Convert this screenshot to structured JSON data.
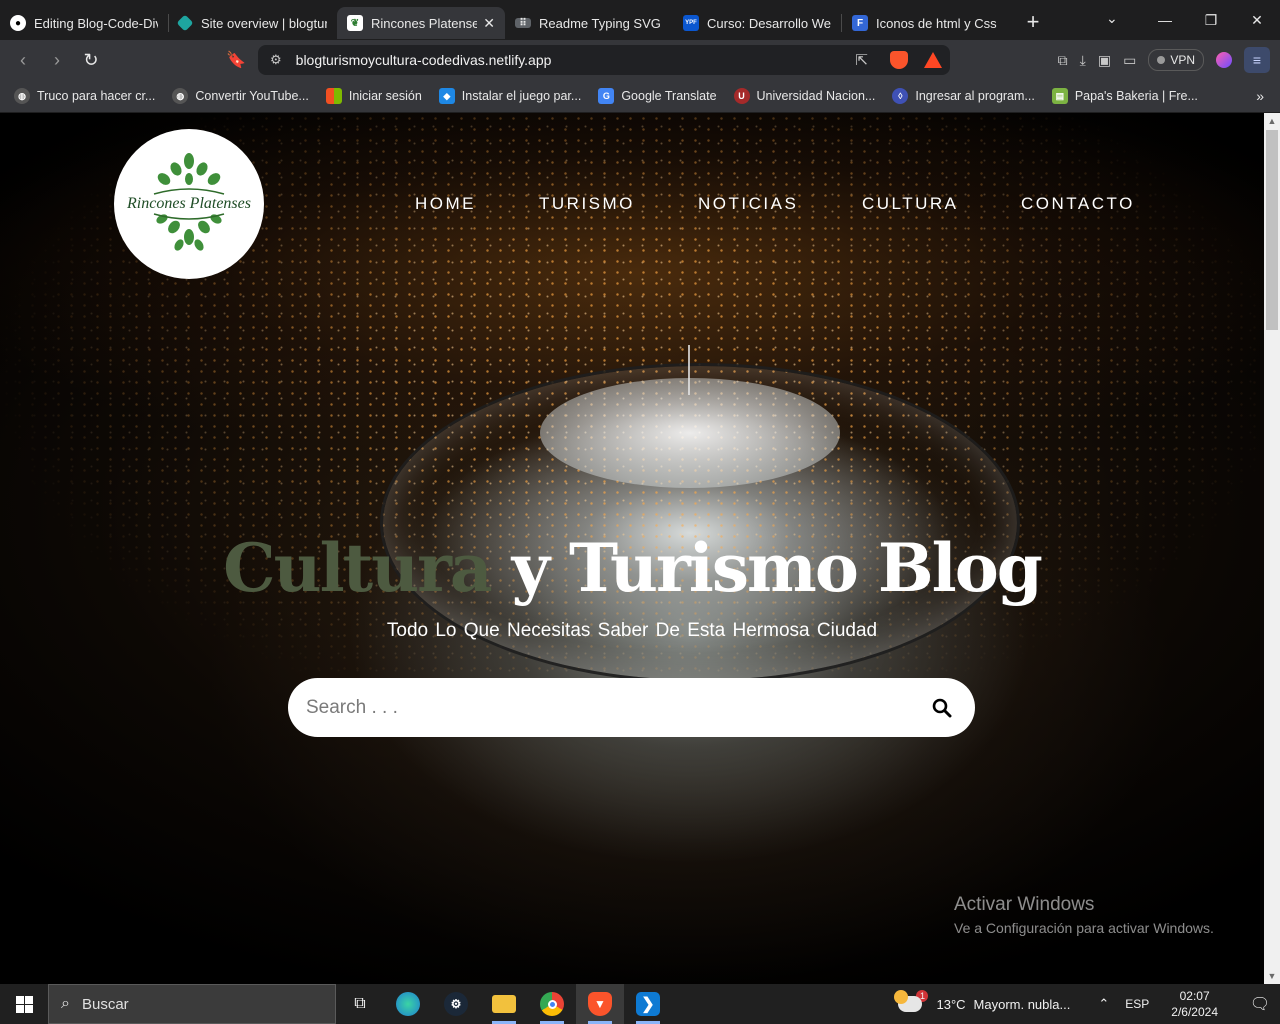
{
  "browser": {
    "tabs": [
      {
        "title": "Editing Blog-Code-Diva",
        "icon": "github-icon",
        "active": false
      },
      {
        "title": "Site overview | blogturi",
        "icon": "netlify-icon",
        "active": false
      },
      {
        "title": "Rincones Platenses",
        "icon": "leaf-icon",
        "active": true
      },
      {
        "title": "Readme Typing SVG - D",
        "icon": "keyboard-icon",
        "active": false
      },
      {
        "title": "Curso: Desarrollo Web",
        "icon": "ypf-icon",
        "active": false
      },
      {
        "title": "Iconos de html y Css | F",
        "icon": "f-icon",
        "active": false
      }
    ],
    "url": "blogturismoycultura-codedivas.netlify.app",
    "vpn_label": "VPN",
    "bookmarks": [
      {
        "label": "Truco para hacer cr...",
        "icon": "globe-icon",
        "color": "#555555"
      },
      {
        "label": "Convertir YouTube...",
        "icon": "globe-icon",
        "color": "#555555"
      },
      {
        "label": "Iniciar sesión",
        "icon": "microsoft-icon",
        "color": "#f25022"
      },
      {
        "label": "Instalar el juego par...",
        "icon": "game-icon",
        "color": "#1e88e5"
      },
      {
        "label": "Google Translate",
        "icon": "translate-icon",
        "color": "#4285f4"
      },
      {
        "label": "Universidad Nacion...",
        "icon": "university-icon",
        "color": "#a52a2a"
      },
      {
        "label": "Ingresar al program...",
        "icon": "shield-icon",
        "color": "#3f51b5"
      },
      {
        "label": "Papa's Bakeria | Fre...",
        "icon": "bakery-icon",
        "color": "#7cb342"
      }
    ]
  },
  "site": {
    "logo_text": "Rincones Platenses",
    "nav": [
      "HOME",
      "TURISMO",
      "NOTICIAS",
      "CULTURA",
      "CONTACTO"
    ],
    "hero_title_part1": "Cultura",
    "hero_title_part2": "y Turismo Blog",
    "hero_subtitle": "Todo Lo Que Necesitas Saber De Esta Hermosa Ciudad",
    "search_placeholder": "Search . . ."
  },
  "windows_watermark": {
    "line1": "Activar Windows",
    "line2": "Ve a Configuración para activar Windows."
  },
  "taskbar": {
    "search_label": "Buscar",
    "weather_temp": "13°C",
    "weather_text": "Mayorm. nubla...",
    "weather_badge": "1",
    "language": "ESP",
    "time": "02:07",
    "date": "2/6/2024"
  },
  "colors": {
    "accent_title": "#4d5a40",
    "tab_active": "#35363a",
    "tabbar": "#1e1e1f",
    "taskbar": "#202020"
  }
}
